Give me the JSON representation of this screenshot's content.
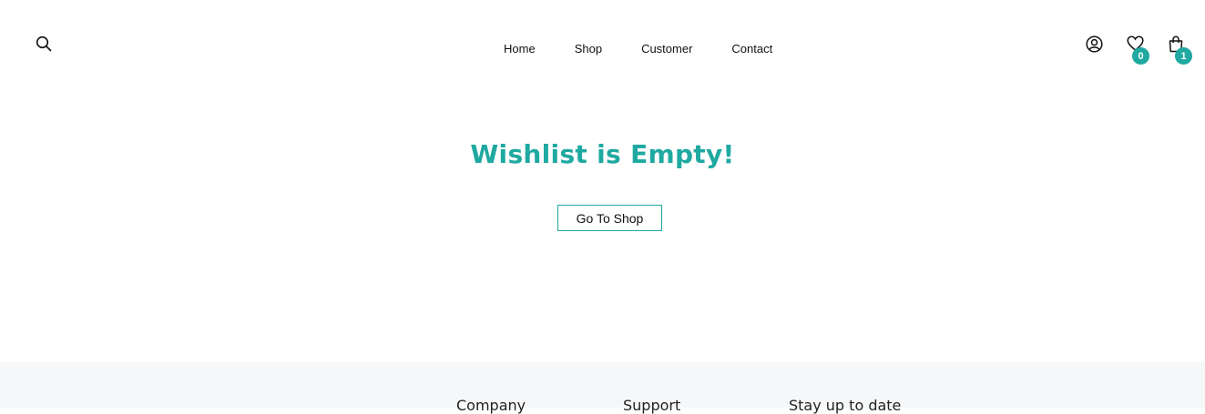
{
  "header": {
    "nav": [
      {
        "label": "Home"
      },
      {
        "label": "Shop"
      },
      {
        "label": "Customer"
      },
      {
        "label": "Contact"
      }
    ],
    "wishlist_count": "0",
    "cart_count": "1"
  },
  "main": {
    "title": "Wishlist is Empty!",
    "button_label": "Go To Shop"
  },
  "footer": {
    "columns": [
      {
        "heading": "Company"
      },
      {
        "heading": "Support"
      },
      {
        "heading": "Stay up to date"
      }
    ]
  },
  "colors": {
    "accent": "#1fa9a1",
    "footer_bg": "#f5f7f9"
  }
}
